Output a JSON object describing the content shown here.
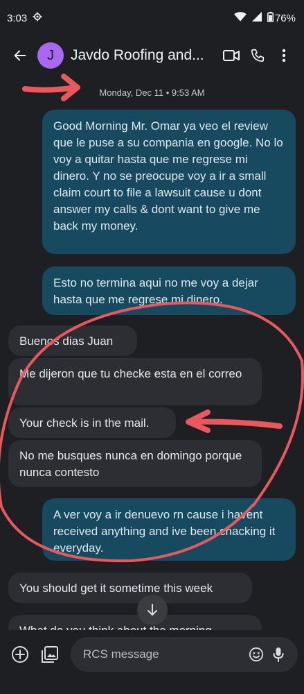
{
  "status": {
    "time": "3:03",
    "battery": "76%"
  },
  "header": {
    "avatar_letter": "J",
    "title": "Javdo Roofing and..."
  },
  "conversation": {
    "date": "Monday, Dec 11 • 9:53 AM",
    "messages": [
      {
        "direction": "sent",
        "text": "Good Morning Mr. Omar ya veo el review que le puse a su compania en google. No lo voy a quitar hasta que me regrese mi dinero. Y no se preocupe voy a ir a small claim court to file a lawsuit cause u dont answer my calls & dont want to give me back my money."
      },
      {
        "direction": "sent",
        "text": "Esto no termina aqui no me voy a dejar hasta que me regrese mi dinero."
      },
      {
        "direction": "received",
        "text": "Buenos dias Juan"
      },
      {
        "direction": "received",
        "text": "Me dijeron que tu checke esta en el correo"
      },
      {
        "direction": "received",
        "text": "Your check is in the mail."
      },
      {
        "direction": "received",
        "text": "No me busques nunca en domingo porque nunca contesto"
      },
      {
        "direction": "sent",
        "text": "A ver voy a ir denuevo rn cause i havent received anything and ive been chacking it everyday."
      },
      {
        "direction": "received",
        "text": "You should get it sometime this week"
      },
      {
        "direction": "received",
        "text": "What do you think about the morning"
      }
    ]
  },
  "composer": {
    "placeholder": "RCS message"
  },
  "colors": {
    "sent_bubble": "#174a5f",
    "received_bubble": "#2c2e33",
    "avatar": "#a868f0",
    "annotation": "#e8585c"
  }
}
